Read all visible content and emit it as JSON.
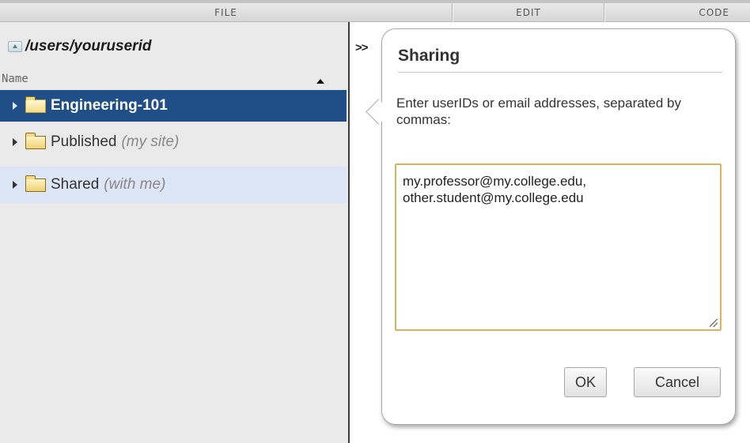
{
  "menubar": {
    "file": "FILE",
    "edit": "EDIT",
    "code": "CODE"
  },
  "filepanel": {
    "path": "/users/youruserid",
    "column_header": "Name",
    "items": [
      {
        "label": "Engineering-101",
        "sub": "",
        "selected": true
      },
      {
        "label": "Published",
        "sub": "(my site)",
        "selected": false
      },
      {
        "label": "Shared",
        "sub": "(with me)",
        "selected": false
      }
    ]
  },
  "editor": {
    "chevrons": ">>"
  },
  "sharing": {
    "title": "Sharing",
    "instructions": "Enter userIDs or email addresses, separated by commas:",
    "input_value": "my.professor@my.college.edu,\nother.student@my.college.edu",
    "ok_label": "OK",
    "cancel_label": "Cancel"
  },
  "colors": {
    "selected_row": "#1f4f86",
    "hover_row": "#dde6f6",
    "input_border": "#e0b05a"
  }
}
